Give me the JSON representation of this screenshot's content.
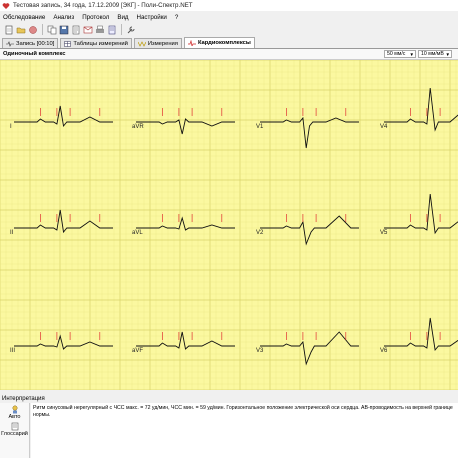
{
  "window": {
    "title": "Тестовая запись, 34 года, 17.12.2009 [ЭКГ] - Поли-Спектр.NET"
  },
  "menu": {
    "items": [
      "Обследование",
      "Анализ",
      "Протокол",
      "Вид",
      "Настройки",
      "?"
    ]
  },
  "tabs": [
    {
      "label": "Запись [00:10]",
      "icon": "waveform-icon"
    },
    {
      "label": "Таблицы измерений",
      "icon": "table-icon"
    },
    {
      "label": "Измерения",
      "icon": "caliper-icon"
    },
    {
      "label": "Кардиокомплексы",
      "icon": "ecg-complex-icon",
      "active": true
    }
  ],
  "ecg": {
    "header": "Одиночный комплекс",
    "speed": "50 мм/с",
    "gain": "10 мм/мВ",
    "leads": [
      "I",
      "aVR",
      "V1",
      "V4",
      "II",
      "aVL",
      "V2",
      "V5",
      "III",
      "aVF",
      "V3",
      "V6"
    ],
    "colors": {
      "paper": "#fbf8a0",
      "grid_minor": "#ece889",
      "grid_major": "#d9d36a",
      "trace": "#111111",
      "marker": "#e03030"
    }
  },
  "interpretation": {
    "header": "Интерпретация",
    "auto_label": "Авто",
    "glossary_label": "Глоссарий",
    "text": "Ритм синусовый нерегулярный с ЧСС макс. = 72 уд/мин, ЧСС мин. = 59 уд/мин. Горизонтальное положение электрической оси сердца. АВ-проводимость на верхней границе нормы."
  }
}
